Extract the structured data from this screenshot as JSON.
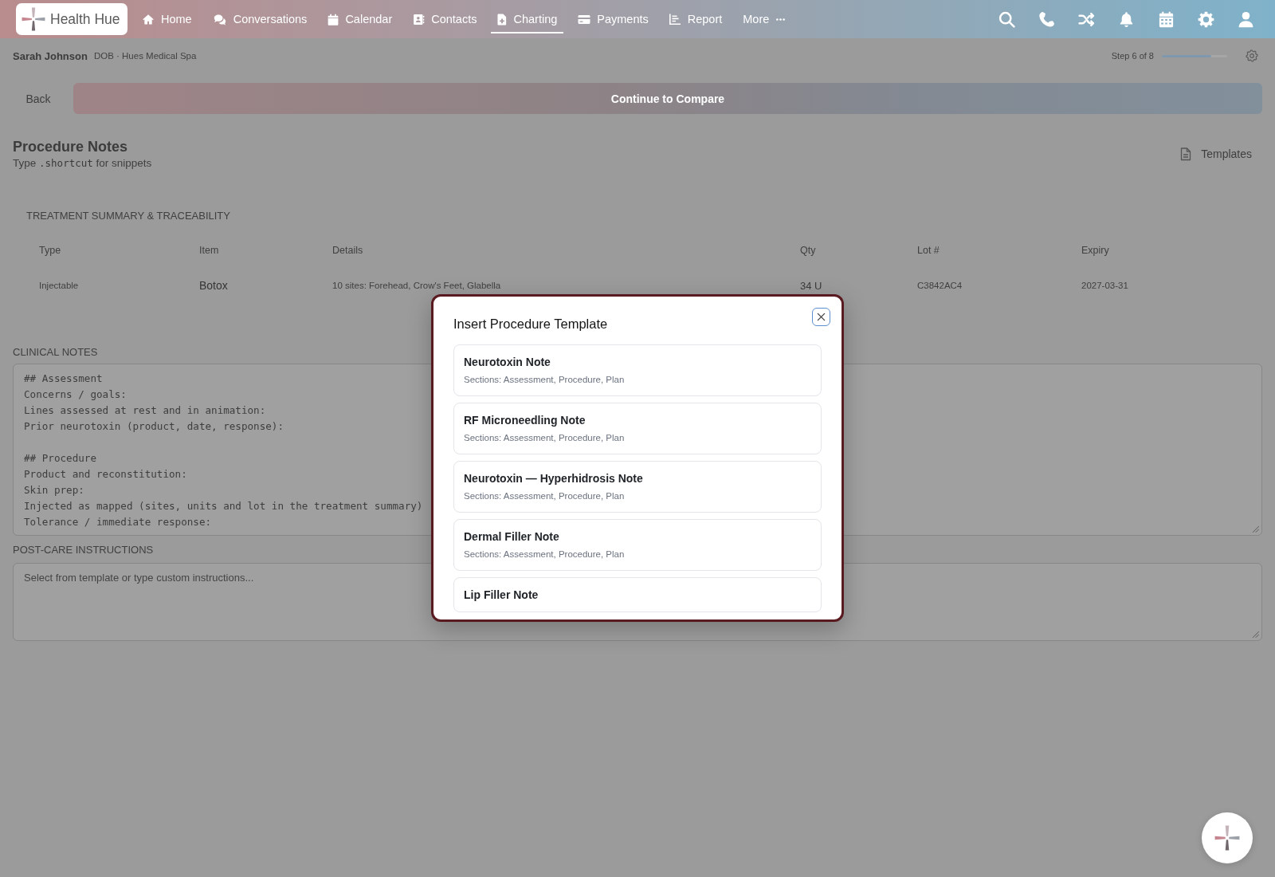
{
  "nav": {
    "logo": "Health Hue",
    "items": [
      {
        "label": "Home",
        "kind": "link",
        "selected": false
      },
      {
        "label": "Conversations",
        "kind": "link",
        "selected": false
      },
      {
        "label": "Calendar",
        "kind": "link",
        "selected": false
      },
      {
        "label": "Contacts",
        "kind": "link",
        "selected": false
      },
      {
        "label": "Charting",
        "kind": "link",
        "selected": true
      },
      {
        "label": "Payments",
        "kind": "link",
        "selected": false
      },
      {
        "label": "Report",
        "kind": "link",
        "selected": false
      },
      {
        "label": "More",
        "kind": "menu",
        "selected": false
      }
    ]
  },
  "patient": {
    "name": "Sarah Johnson",
    "details": "DOB · Hues Medical Spa",
    "step": {
      "label": "Step 6 of 8",
      "level": 0.75
    }
  },
  "actions": {
    "back": "Back",
    "continue": "Continue to Compare"
  },
  "procedure_notes": {
    "title": "Procedure Notes",
    "hint": {
      "before": "Type",
      "code": ".shortcut",
      "after": "for snippets"
    },
    "templates_button": "Templates"
  },
  "treatment_summary": {
    "title": "TREATMENT SUMMARY & TRACEABILITY",
    "columns": [
      "Type",
      "Item",
      "Details",
      "Qty",
      "Lot #",
      "Expiry"
    ],
    "rows": [
      [
        "Injectable",
        "Botox",
        "10 sites: Forehead, Crow's Feet, Glabella",
        "34 U",
        "C3842AC4",
        "2027-03-31"
      ]
    ]
  },
  "clinical_notes": {
    "label": "CLINICAL NOTES",
    "value": "## Assessment\nConcerns / goals:\nLines assessed at rest and in animation:\nPrior neurotoxin (product, date, response):\n\n## Procedure\nProduct and reconstitution:\nSkin prep:\nInjected as mapped (sites, units and lot in the treatment summary)\nTolerance / immediate response:"
  },
  "post_care": {
    "label": "POST-CARE INSTRUCTIONS",
    "placeholder": "Select from template or type custom instructions..."
  },
  "dialog": {
    "title": "Insert Procedure Template",
    "templates": [
      {
        "name": "Neurotoxin Note",
        "sections": "Sections: Assessment, Procedure, Plan"
      },
      {
        "name": "RF Microneedling Note",
        "sections": "Sections: Assessment, Procedure, Plan"
      },
      {
        "name": "Neurotoxin — Hyperhidrosis Note",
        "sections": "Sections: Assessment, Procedure, Plan"
      },
      {
        "name": "Dermal Filler Note",
        "sections": "Sections: Assessment, Procedure, Plan"
      },
      {
        "name": "Lip Filler Note"
      }
    ]
  }
}
